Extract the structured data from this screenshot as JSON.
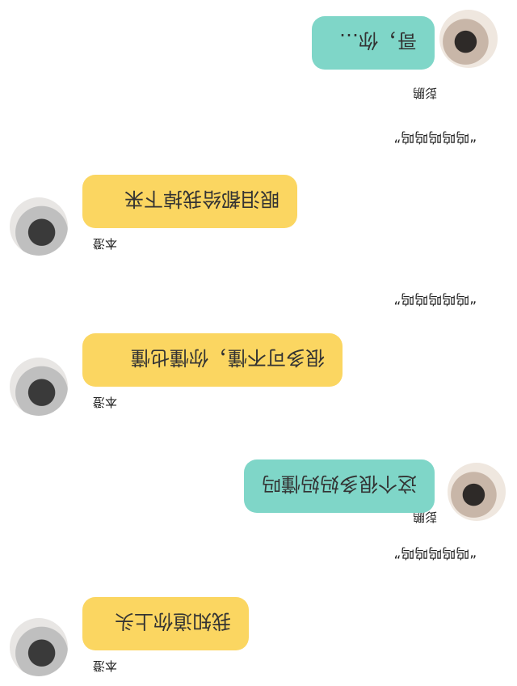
{
  "messages": [
    {
      "side": "left",
      "sender": "本澄",
      "text": "我知道你上头",
      "color": "#fbd661"
    },
    {
      "type": "system",
      "text": "“呜呜呜呜呜”"
    },
    {
      "side": "right",
      "sender": "彭鹏",
      "text": "这个很多妈妈懂吗",
      "color": "#7fd6c8"
    },
    {
      "side": "left",
      "sender": "本澄",
      "text": "很多可不懂，你懂也懂",
      "color": "#fbd661"
    },
    {
      "type": "system",
      "text": "“呜呜呜呜呜”"
    },
    {
      "side": "left",
      "sender": "本澄",
      "text": "眼泪都给我掉下来",
      "color": "#fbd661"
    },
    {
      "type": "system",
      "text": "“呜呜呜呜呜”"
    },
    {
      "side": "right",
      "sender": "彭鹏",
      "text": "哥，你…",
      "color": "#7fd6c8"
    }
  ]
}
